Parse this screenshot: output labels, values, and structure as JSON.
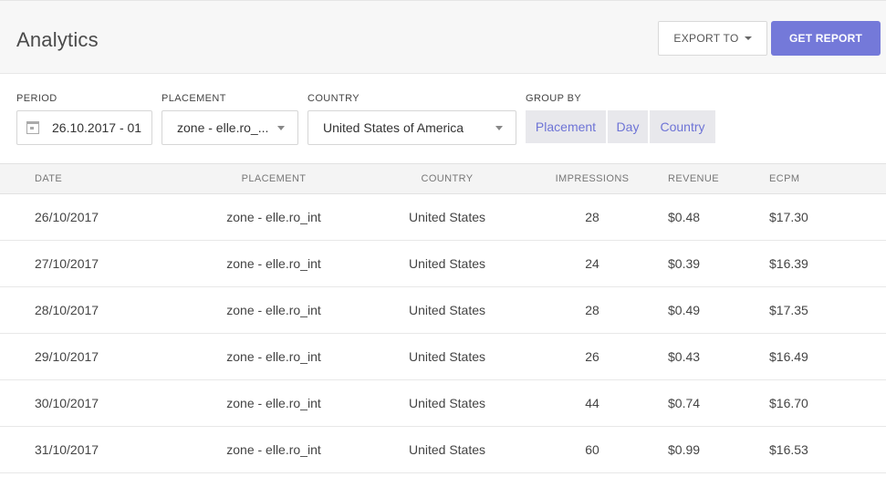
{
  "header": {
    "title": "Analytics",
    "export_label": "EXPORT TO",
    "report_label": "GET REPORT"
  },
  "filters": {
    "period_label": "PERIOD",
    "period_value": "26.10.2017 - 01",
    "placement_label": "PLACEMENT",
    "placement_value": "zone - elle.ro_...",
    "country_label": "COUNTRY",
    "country_value": "United States of America",
    "group_label": "GROUP BY",
    "group_options": [
      "Placement",
      "Day",
      "Country"
    ]
  },
  "table": {
    "columns": [
      "DATE",
      "PLACEMENT",
      "COUNTRY",
      "IMPRESSIONS",
      "REVENUE",
      "ECPM"
    ],
    "rows": [
      [
        "26/10/2017",
        "zone - elle.ro_int",
        "United States",
        "28",
        "$0.48",
        "$17.30"
      ],
      [
        "27/10/2017",
        "zone - elle.ro_int",
        "United States",
        "24",
        "$0.39",
        "$16.39"
      ],
      [
        "28/10/2017",
        "zone - elle.ro_int",
        "United States",
        "28",
        "$0.49",
        "$17.35"
      ],
      [
        "29/10/2017",
        "zone - elle.ro_int",
        "United States",
        "26",
        "$0.43",
        "$16.49"
      ],
      [
        "30/10/2017",
        "zone - elle.ro_int",
        "United States",
        "44",
        "$0.74",
        "$16.70"
      ],
      [
        "31/10/2017",
        "zone - elle.ro_int",
        "United States",
        "60",
        "$0.99",
        "$16.53"
      ]
    ]
  },
  "colors": {
    "accent": "#7479d9",
    "group_button_bg": "#e8e8ec"
  },
  "icons": {
    "period": "calendar-icon",
    "export": "caret-down-icon",
    "select": "chevron-down-icon"
  }
}
